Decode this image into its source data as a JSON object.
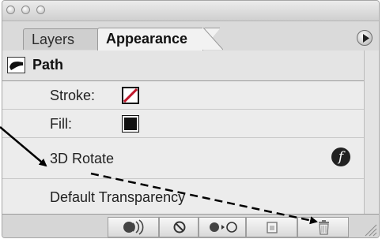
{
  "window": {
    "controls": [
      "close-button",
      "minimize-button",
      "zoom-button"
    ]
  },
  "tabs": [
    {
      "label": "Layers",
      "active": false
    },
    {
      "label": "Appearance",
      "active": true
    }
  ],
  "panel_menu_icon": "triangle-right-icon",
  "rows": {
    "path": {
      "label": "Path"
    },
    "stroke": {
      "label": "Stroke:",
      "swatch": "none-stroke-icon",
      "color": "#c0172b"
    },
    "fill": {
      "label": "Fill:",
      "swatch_color": "#111111"
    },
    "rotate": {
      "label": "3D Rotate",
      "effect_icon": "fx-icon",
      "effect_icon_text": "f"
    },
    "transparency": {
      "label": "Default Transparency"
    }
  },
  "toolbar": {
    "buttons": [
      {
        "icon": "new-art-maintains-appearance-icon"
      },
      {
        "icon": "clear-appearance-icon"
      },
      {
        "icon": "reduce-to-basic-appearance-icon"
      },
      {
        "icon": "duplicate-selected-item-icon"
      },
      {
        "icon": "delete-selected-item-icon"
      }
    ]
  },
  "colors": {
    "panel_bg": "#dadada",
    "list_bg": "#ececec",
    "accent_red": "#c0172b"
  }
}
